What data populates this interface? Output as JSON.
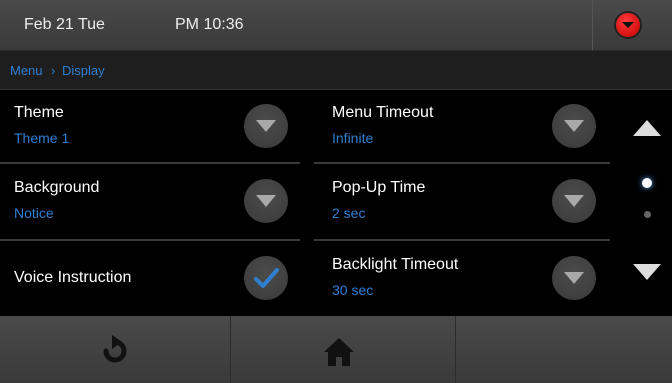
{
  "status_bar": {
    "date": "Feb 21 Tue",
    "time": "PM 10:36"
  },
  "breadcrumb": {
    "path1": "Menu",
    "path2": "Display"
  },
  "settings": {
    "left": [
      {
        "label": "Theme",
        "value": "Theme 1"
      },
      {
        "label": "Background",
        "value": "Notice"
      },
      {
        "label": "Voice Instruction",
        "value": ""
      }
    ],
    "right": [
      {
        "label": "Menu Timeout",
        "value": "Infinite"
      },
      {
        "label": "Pop-Up Time",
        "value": "2 sec"
      },
      {
        "label": "Backlight Timeout",
        "value": "30 sec"
      }
    ]
  },
  "colors": {
    "accent": "#2f7fd1",
    "alert": "#d10000",
    "check": "#2f7fd1"
  },
  "icons": {
    "alert": "red-chevron-down-icon",
    "dropdown": "chevron-down-icon",
    "check": "checkmark-icon",
    "scroll_up": "arrow-up-icon",
    "scroll_down": "arrow-down-icon",
    "refresh": "refresh-icon",
    "home": "home-icon"
  },
  "page_indicator": {
    "current": 1,
    "total": 2
  }
}
